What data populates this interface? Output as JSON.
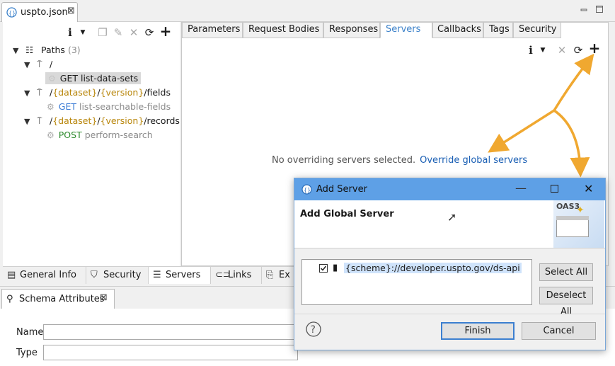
{
  "editor": {
    "file_tab": "uspto.json",
    "tab_close": "⊠"
  },
  "tree": {
    "paths_label": "Paths",
    "paths_count": "(3)",
    "root_path": "/",
    "root_op_method": "GET",
    "root_op_name": "list-data-sets",
    "fields_path": {
      "p1": "/",
      "dataset": "{dataset}",
      "p2": "/",
      "version": "{version}",
      "p3": "/fields"
    },
    "fields_op_method": "GET",
    "fields_op_name": "list-searchable-fields",
    "records_path": {
      "p1": "/",
      "dataset": "{dataset}",
      "p2": "/",
      "version": "{version}",
      "p3": "/records"
    },
    "records_op_method": "POST",
    "records_op_name": "perform-search"
  },
  "subtabs": [
    "Parameters",
    "Request Bodies",
    "Responses",
    "Servers",
    "Callbacks",
    "Tags",
    "Security"
  ],
  "servers_panel": {
    "message": "No overriding servers selected.",
    "link": "Override global servers"
  },
  "bottom_tabs": [
    "General Info",
    "Security",
    "Servers",
    "Links",
    "Ex"
  ],
  "schema": {
    "title": "Schema Attributes",
    "close": "⊠",
    "name_label": "Name",
    "type_label": "Type"
  },
  "dialog": {
    "title": "Add Server",
    "heading": "Add Global Server",
    "badge": "OAS3",
    "server_url": "{scheme}://developer.uspto.gov/ds-api",
    "server_checked": true,
    "select_all": "Select All",
    "deselect_all": "Deselect All",
    "finish": "Finish",
    "cancel": "Cancel"
  },
  "colors": {
    "accent": "#3a80c9",
    "arrow": "#f0a830",
    "dialog_titlebar": "#5ea0e6",
    "get": "#3a7bd5",
    "post": "#2e8b2e"
  }
}
